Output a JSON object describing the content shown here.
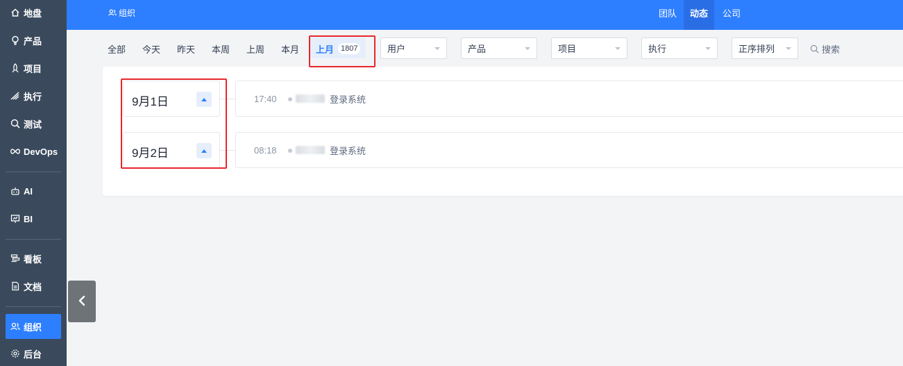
{
  "sidebar": {
    "items": [
      {
        "label": "地盘",
        "icon": "home-icon"
      },
      {
        "label": "产品",
        "icon": "bulb-icon"
      },
      {
        "label": "项目",
        "icon": "rocket-icon"
      },
      {
        "label": "执行",
        "icon": "send-icon"
      },
      {
        "label": "测试",
        "icon": "bug-search-icon"
      },
      {
        "label": "DevOps",
        "icon": "infinity-icon"
      },
      {
        "label": "AI",
        "icon": "robot-icon"
      },
      {
        "label": "BI",
        "icon": "presentation-icon"
      },
      {
        "label": "看板",
        "icon": "kanban-icon"
      },
      {
        "label": "文档",
        "icon": "document-icon"
      },
      {
        "label": "组织",
        "icon": "users-icon"
      },
      {
        "label": "后台",
        "icon": "gear-icon"
      }
    ],
    "active": "组织"
  },
  "topbar": {
    "breadcrumb": "组织",
    "nav": [
      {
        "label": "团队"
      },
      {
        "label": "动态"
      },
      {
        "label": "公司"
      }
    ],
    "active": "动态"
  },
  "filters": {
    "periods": [
      "全部",
      "今天",
      "昨天",
      "本周",
      "上周",
      "本月",
      "上月"
    ],
    "active_period": "上月",
    "count": "1807",
    "selects": {
      "user": "用户",
      "product": "产品",
      "project": "项目",
      "execution": "执行",
      "order": "正序排列"
    },
    "search_label": "搜索"
  },
  "timeline": {
    "groups": [
      {
        "date": "9月1日",
        "time": "17:40",
        "action": "登录系统"
      },
      {
        "date": "9月2日",
        "time": "08:18",
        "action": "登录系统"
      }
    ]
  },
  "colors": {
    "sidebar_bg": "#3a4a5c",
    "primary": "#2e7fff",
    "highlight": "#e8262b"
  }
}
